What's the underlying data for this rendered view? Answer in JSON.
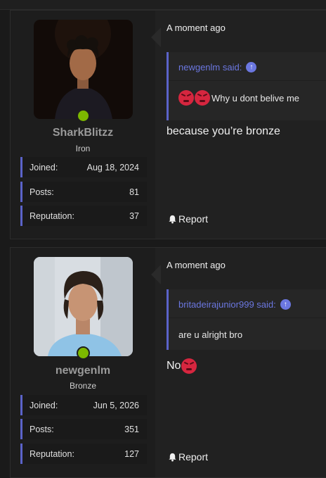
{
  "posts": [
    {
      "username": "SharkBlitzz",
      "rank": "Iron",
      "stats": [
        {
          "label": "Joined:",
          "value": "Aug 18, 2024"
        },
        {
          "label": "Posts:",
          "value": "81"
        },
        {
          "label": "Reputation:",
          "value": "37"
        }
      ],
      "time": "A moment ago",
      "quote_author": "newgenlm said:",
      "quote_text": "Why u dont belive me",
      "reply_text": "because you’re bronze",
      "report_label": "Report"
    },
    {
      "username": "newgenlm",
      "rank": "Bronze",
      "stats": [
        {
          "label": "Joined:",
          "value": "Jun 5, 2026"
        },
        {
          "label": "Posts:",
          "value": "351"
        },
        {
          "label": "Reputation:",
          "value": "127"
        }
      ],
      "time": "A moment ago",
      "quote_author": "britadeirajunior999 said:",
      "quote_text": "are u alright bro",
      "reply_text": "No",
      "report_label": "Report"
    }
  ],
  "colors": {
    "accent": "#5b63c9",
    "link": "#6b77e0",
    "online": "#7cb800",
    "emoji": "#d6263f"
  }
}
